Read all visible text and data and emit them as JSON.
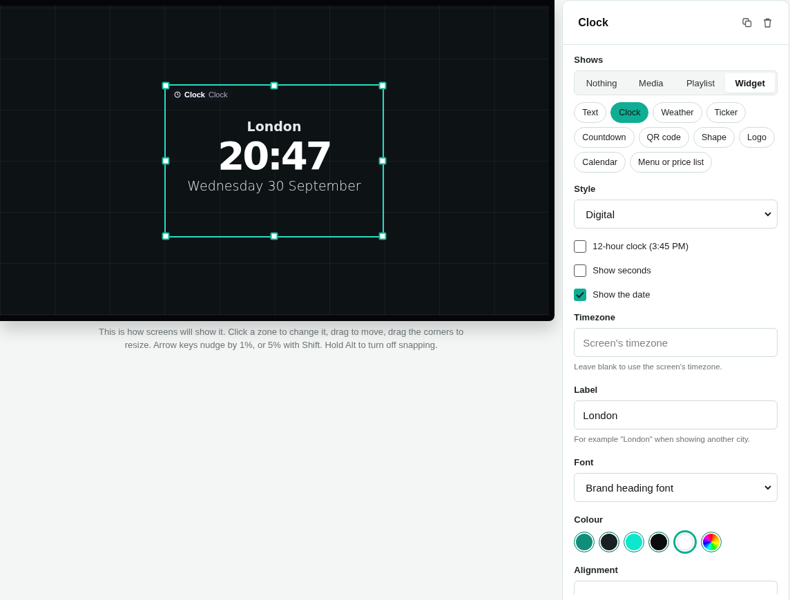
{
  "preview": {
    "zone": {
      "kind_label": "Clock",
      "name": "Clock",
      "label": "London",
      "time": "20:47",
      "date": "Wednesday 30 September",
      "selected": true
    },
    "caption": "This is how screens will show it. Click a zone to change it, drag to move, drag the corners to resize. Arrow keys nudge by 1%, or 5% with Shift. Hold Alt to turn off snapping."
  },
  "panel": {
    "title": "Clock",
    "shows": {
      "label": "Shows",
      "tabs": [
        {
          "label": "Nothing",
          "selected": false
        },
        {
          "label": "Media",
          "selected": false
        },
        {
          "label": "Playlist",
          "selected": false
        },
        {
          "label": "Widget",
          "selected": true
        }
      ]
    },
    "widgets": [
      {
        "label": "Text",
        "selected": false
      },
      {
        "label": "Clock",
        "selected": true
      },
      {
        "label": "Weather",
        "selected": false
      },
      {
        "label": "Ticker",
        "selected": false
      },
      {
        "label": "Countdown",
        "selected": false
      },
      {
        "label": "QR code",
        "selected": false
      },
      {
        "label": "Shape",
        "selected": false
      },
      {
        "label": "Logo",
        "selected": false
      },
      {
        "label": "Calendar",
        "selected": false
      },
      {
        "label": "Menu or price list",
        "selected": false
      }
    ],
    "style": {
      "label": "Style",
      "value": "Digital"
    },
    "options": [
      {
        "label": "12-hour clock (3:45 PM)",
        "checked": false
      },
      {
        "label": "Show seconds",
        "checked": false
      },
      {
        "label": "Show the date",
        "checked": true
      }
    ],
    "timezone": {
      "label": "Timezone",
      "placeholder": "Screen's timezone",
      "hint": "Leave blank to use the screen's timezone."
    },
    "label_field": {
      "label": "Label",
      "value": "London",
      "hint": "For example \"London\" when showing another city."
    },
    "font": {
      "label": "Font",
      "value": "Brand heading font"
    },
    "colour": {
      "label": "Colour",
      "swatches": [
        {
          "kind": "solid",
          "color": "#0f8f7a",
          "selected": false
        },
        {
          "kind": "solid",
          "color": "#182024",
          "selected": false
        },
        {
          "kind": "solid",
          "color": "#0ce8cc",
          "selected": false
        },
        {
          "kind": "solid",
          "color": "#0a0b0c",
          "selected": false
        },
        {
          "kind": "solid",
          "color": "#ffffff",
          "selected": true
        },
        {
          "kind": "custom",
          "selected": false
        }
      ]
    },
    "alignment": {
      "label": "Alignment"
    }
  }
}
